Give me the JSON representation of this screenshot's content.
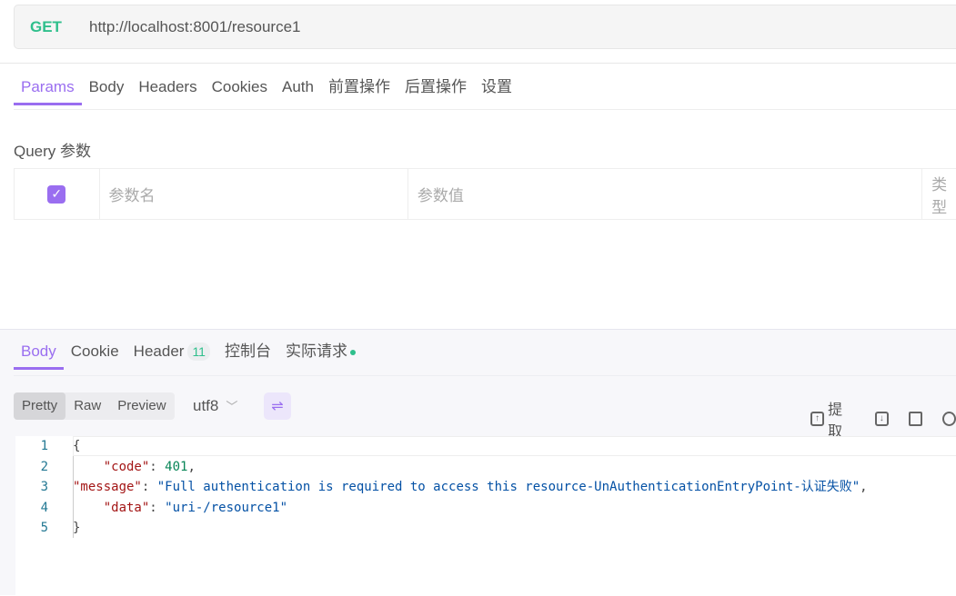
{
  "request": {
    "method": "GET",
    "url": "http://localhost:8001/resource1"
  },
  "request_tabs": [
    "Params",
    "Body",
    "Headers",
    "Cookies",
    "Auth",
    "前置操作",
    "后置操作",
    "设置"
  ],
  "query": {
    "label": "Query 参数",
    "columns": [
      "参数名",
      "参数值",
      "类型"
    ]
  },
  "response_tabs": {
    "body": "Body",
    "cookie": "Cookie",
    "header": "Header",
    "header_count": "11",
    "console": "控制台",
    "actual": "实际请求"
  },
  "view_modes": [
    "Pretty",
    "Raw",
    "Preview"
  ],
  "encoding": "utf8",
  "toolbar": {
    "extract": "提取"
  },
  "code": {
    "line_numbers": [
      "1",
      "2",
      "3",
      "",
      "4",
      "5"
    ],
    "open": "{",
    "close": "}",
    "code_key": "\"code\"",
    "code_val": "401",
    "message_key": "\"message\"",
    "message_val": "\"Full authentication is required to access this resource-UnAuthenticationEntryPoint-认证失败\"",
    "data_key": "\"data\"",
    "data_val": "\"uri-/resource1\""
  },
  "colors": {
    "accent": "#9a6ef0",
    "method": "#2fbf8c"
  }
}
